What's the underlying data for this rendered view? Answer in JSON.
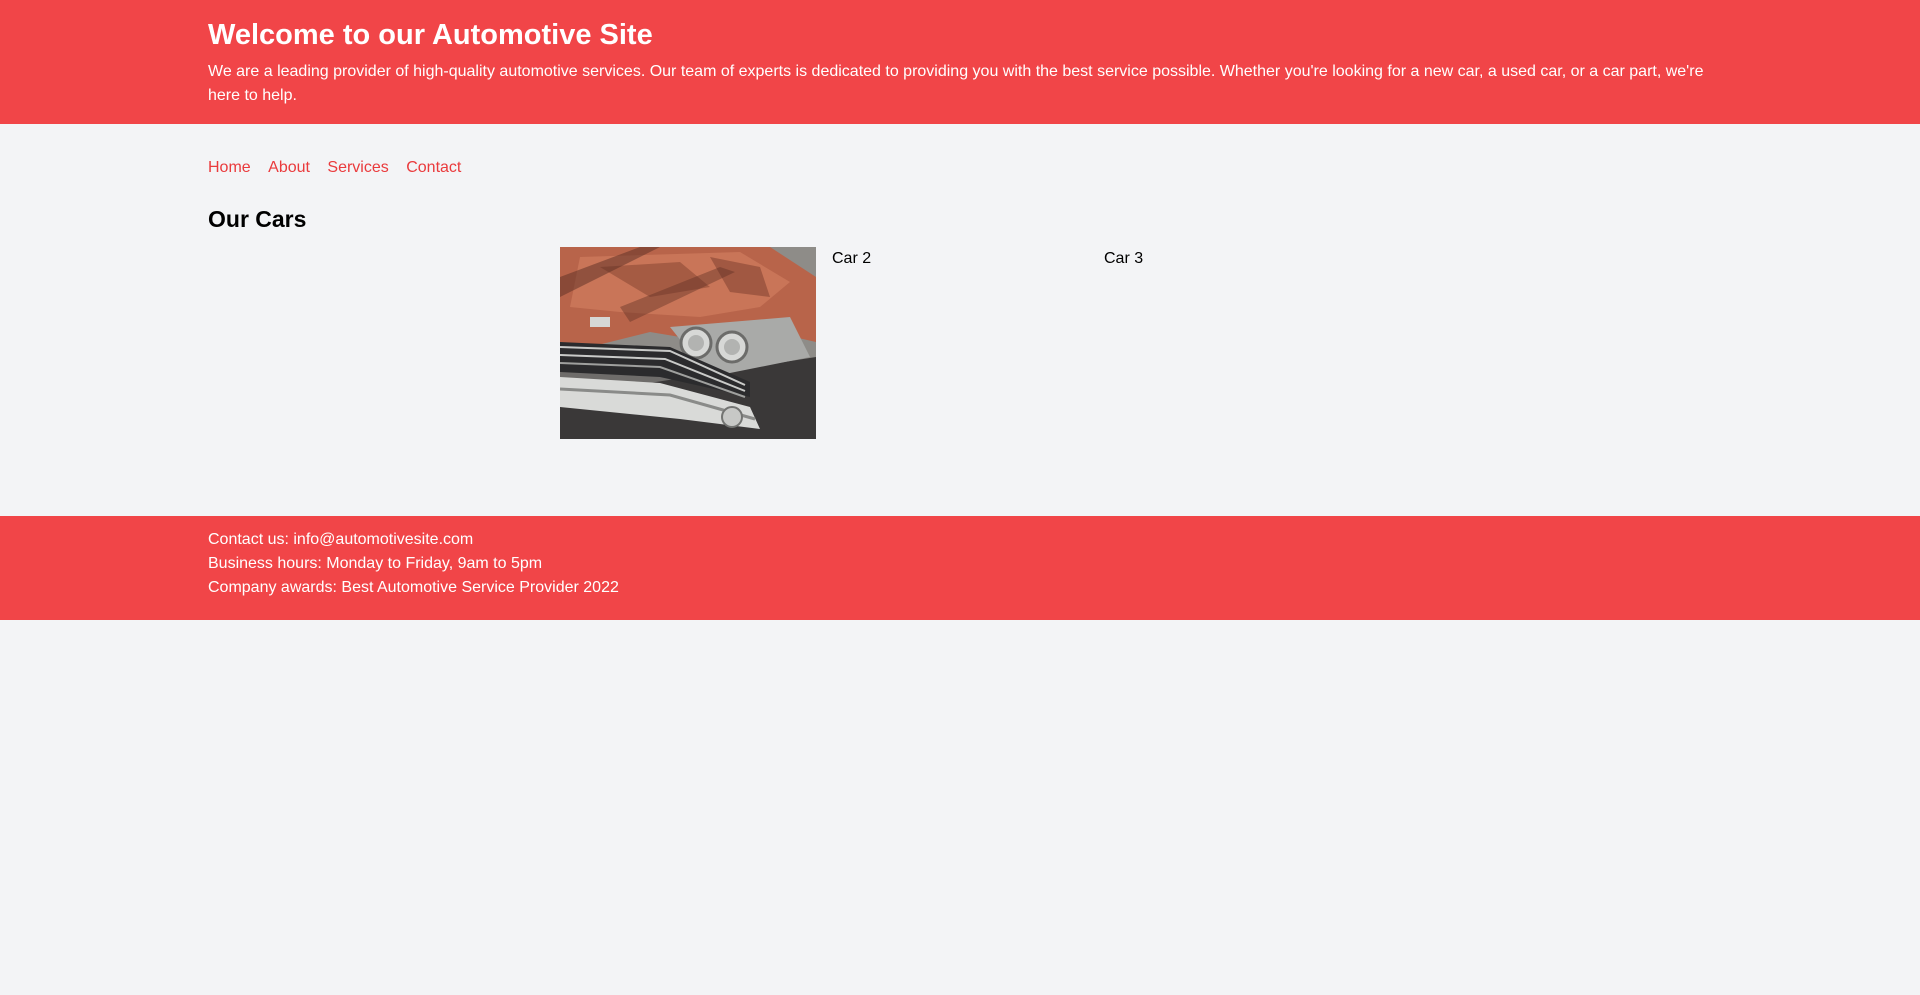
{
  "header": {
    "title": "Welcome to our Automotive Site",
    "intro": "We are a leading provider of high-quality automotive services. Our team of experts is dedicated to providing you with the best service possible. Whether you're looking for a new car, a used car, or a car part, we're here to help."
  },
  "nav": {
    "items": [
      {
        "label": "Home"
      },
      {
        "label": "About"
      },
      {
        "label": "Services"
      },
      {
        "label": "Contact"
      }
    ]
  },
  "cars": {
    "heading": "Our Cars",
    "items": [
      {
        "label": "Car 2"
      },
      {
        "label": "Car 3"
      }
    ]
  },
  "footer": {
    "contact": "Contact us: info@automotivesite.com",
    "hours": "Business hours: Monday to Friday, 9am to 5pm",
    "awards": "Company awards: Best Automotive Service Provider 2022"
  },
  "colors": {
    "brand": "#f14548",
    "link": "#ea3a3c",
    "background": "#f3f4f6"
  }
}
